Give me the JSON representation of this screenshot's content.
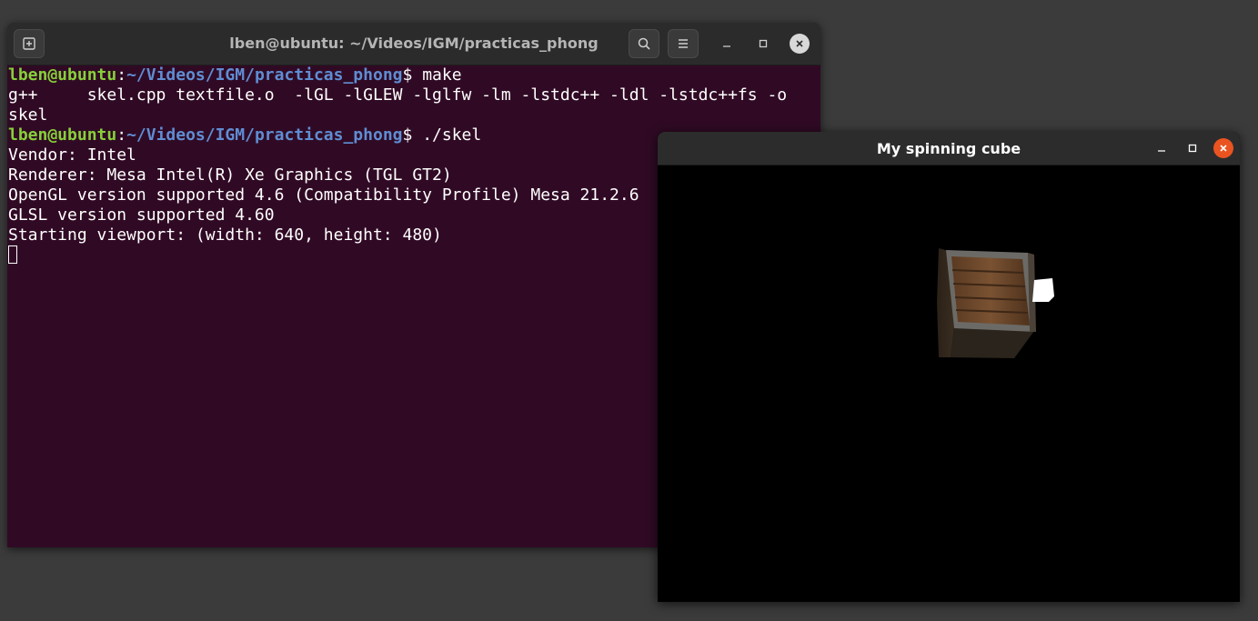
{
  "terminal": {
    "title": "lben@ubuntu: ~/Videos/IGM/practicas_phong",
    "prompt_user": "lben@ubuntu",
    "prompt_sep": ":",
    "prompt_path": "~/Videos/IGM/practicas_phong",
    "prompt_dollar": "$ ",
    "cmd1": "make",
    "out1a": "g++     skel.cpp textfile.o  -lGL -lGLEW -lglfw -lm -lstdc++ -ldl -lstdc++fs -o",
    "out1b": "skel",
    "cmd2": "./skel",
    "output": [
      "Vendor: Intel",
      "Renderer: Mesa Intel(R) Xe Graphics (TGL GT2)",
      "OpenGL version supported 4.6 (Compatibility Profile) Mesa 21.2.6",
      "GLSL version supported 4.60",
      "Starting viewport: (width: 640, height: 480)"
    ],
    "colors": {
      "background": "#300a24",
      "prompt_user": "#87d03a",
      "prompt_path": "#5f8dd3"
    }
  },
  "gl_window": {
    "title": "My spinning cube",
    "close_color": "#e95420"
  }
}
